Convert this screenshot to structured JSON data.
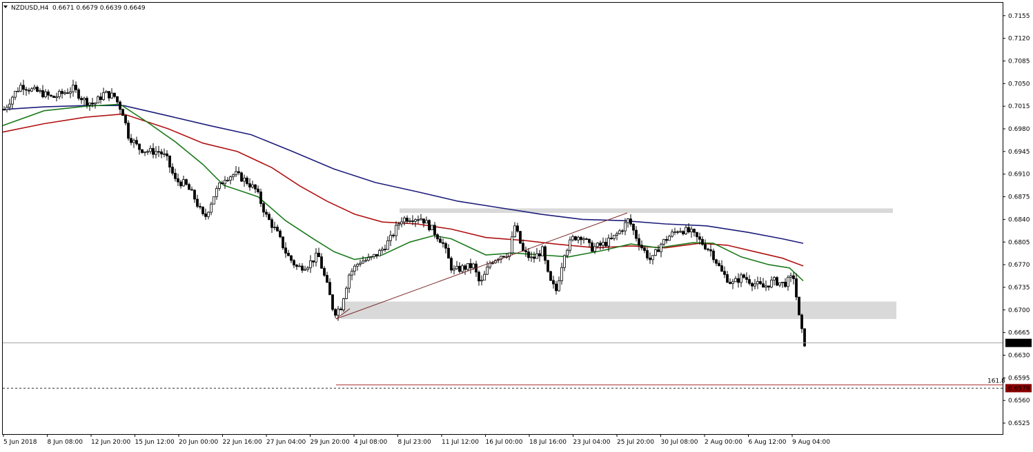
{
  "window": {
    "symbol_header": "NZDUSD,H4",
    "ohlc_header": "0.6671 0.6679 0.6639 0.6649",
    "menu_icon": "triangle-down-icon"
  },
  "chart_data": {
    "type": "candlestick",
    "symbol": "NZDUSD",
    "timeframe": "H4",
    "ylim": [
      0.6508,
      0.7175
    ],
    "y_ticks": [
      0.7155,
      0.712,
      0.7085,
      0.705,
      0.7015,
      0.698,
      0.6945,
      0.691,
      0.6875,
      0.684,
      0.6805,
      0.677,
      0.6735,
      0.67,
      0.6665,
      0.663,
      0.6595,
      0.656,
      0.6525
    ],
    "y_tick_labels": [
      "0.7155",
      "0.7120",
      "0.7085",
      "0.7050",
      "0.7015",
      "0.6980",
      "0.6945",
      "0.6910",
      "0.6875",
      "0.6840",
      "0.6805",
      "0.6770",
      "0.6735",
      "0.6700",
      "0.6665",
      "0.6630",
      "0.6595",
      "0.6560",
      "0.6525"
    ],
    "x_labels": [
      "5 Jun 2018",
      "8 Jun 08:00",
      "12 Jun 20:00",
      "15 Jun 12:00",
      "20 Jun 00:00",
      "22 Jun 16:00",
      "27 Jun 04:00",
      "29 Jun 20:00",
      "4 Jul 08:00",
      "8 Jul 23:00",
      "11 Jul 12:00",
      "16 Jul 00:00",
      "18 Jul 16:00",
      "23 Jul 04:00",
      "25 Jul 20:00",
      "30 Jul 08:00",
      "2 Aug 00:00",
      "6 Aug 12:00",
      "9 Aug 04:00"
    ],
    "price_path": [
      [
        0,
        0.701
      ],
      [
        15,
        0.7035
      ],
      [
        25,
        0.7048
      ],
      [
        40,
        0.704
      ],
      [
        55,
        0.7035
      ],
      [
        70,
        0.7028
      ],
      [
        85,
        0.7035
      ],
      [
        100,
        0.7042
      ],
      [
        115,
        0.7025
      ],
      [
        130,
        0.7018
      ],
      [
        145,
        0.7035
      ],
      [
        160,
        0.703
      ],
      [
        172,
        0.7005
      ],
      [
        180,
        0.697
      ],
      [
        195,
        0.695
      ],
      [
        210,
        0.6945
      ],
      [
        225,
        0.6945
      ],
      [
        235,
        0.6935
      ],
      [
        248,
        0.69
      ],
      [
        262,
        0.6895
      ],
      [
        275,
        0.6875
      ],
      [
        290,
        0.684
      ],
      [
        305,
        0.688
      ],
      [
        320,
        0.6905
      ],
      [
        335,
        0.691
      ],
      [
        350,
        0.69
      ],
      [
        365,
        0.6885
      ],
      [
        380,
        0.6845
      ],
      [
        395,
        0.682
      ],
      [
        410,
        0.6785
      ],
      [
        425,
        0.6765
      ],
      [
        440,
        0.677
      ],
      [
        455,
        0.6785
      ],
      [
        470,
        0.673
      ],
      [
        478,
        0.6695
      ],
      [
        488,
        0.6705
      ],
      [
        500,
        0.6755
      ],
      [
        515,
        0.6775
      ],
      [
        530,
        0.6778
      ],
      [
        545,
        0.679
      ],
      [
        560,
        0.681
      ],
      [
        575,
        0.684
      ],
      [
        590,
        0.6843
      ],
      [
        605,
        0.6842
      ],
      [
        620,
        0.6825
      ],
      [
        635,
        0.6805
      ],
      [
        650,
        0.676
      ],
      [
        665,
        0.6765
      ],
      [
        680,
        0.6768
      ],
      [
        690,
        0.6738
      ],
      [
        705,
        0.6775
      ],
      [
        720,
        0.6785
      ],
      [
        732,
        0.6788
      ],
      [
        740,
        0.683
      ],
      [
        752,
        0.679
      ],
      [
        765,
        0.6778
      ],
      [
        780,
        0.6792
      ],
      [
        790,
        0.6745
      ],
      [
        800,
        0.673
      ],
      [
        812,
        0.679
      ],
      [
        825,
        0.6812
      ],
      [
        838,
        0.6815
      ],
      [
        850,
        0.6795
      ],
      [
        865,
        0.68
      ],
      [
        880,
        0.6808
      ],
      [
        895,
        0.6825
      ],
      [
        905,
        0.684
      ],
      [
        915,
        0.6815
      ],
      [
        925,
        0.6795
      ],
      [
        938,
        0.6775
      ],
      [
        950,
        0.68
      ],
      [
        965,
        0.6815
      ],
      [
        978,
        0.6825
      ],
      [
        995,
        0.682
      ],
      [
        1010,
        0.6805
      ],
      [
        1025,
        0.679
      ],
      [
        1040,
        0.6758
      ],
      [
        1055,
        0.674
      ],
      [
        1070,
        0.6752
      ],
      [
        1085,
        0.6742
      ],
      [
        1100,
        0.6735
      ],
      [
        1115,
        0.6745
      ],
      [
        1130,
        0.674
      ],
      [
        1145,
        0.6752
      ],
      [
        1150,
        0.67
      ],
      [
        1155,
        0.667
      ],
      [
        1160,
        0.6649
      ]
    ],
    "ma_fast_green": [
      [
        0,
        0.6985
      ],
      [
        60,
        0.7008
      ],
      [
        120,
        0.7015
      ],
      [
        170,
        0.7018
      ],
      [
        210,
        0.699
      ],
      [
        250,
        0.696
      ],
      [
        290,
        0.6925
      ],
      [
        320,
        0.6893
      ],
      [
        370,
        0.6875
      ],
      [
        410,
        0.6838
      ],
      [
        450,
        0.681
      ],
      [
        480,
        0.679
      ],
      [
        510,
        0.6778
      ],
      [
        550,
        0.6785
      ],
      [
        590,
        0.6805
      ],
      [
        625,
        0.6815
      ],
      [
        650,
        0.681
      ],
      [
        700,
        0.6785
      ],
      [
        740,
        0.6788
      ],
      [
        780,
        0.6785
      ],
      [
        820,
        0.6782
      ],
      [
        870,
        0.6792
      ],
      [
        910,
        0.6802
      ],
      [
        950,
        0.6796
      ],
      [
        1000,
        0.6804
      ],
      [
        1030,
        0.6803
      ],
      [
        1070,
        0.6782
      ],
      [
        1110,
        0.677
      ],
      [
        1140,
        0.6765
      ],
      [
        1160,
        0.6745
      ]
    ],
    "ma_mid_red": [
      [
        0,
        0.6975
      ],
      [
        60,
        0.6988
      ],
      [
        120,
        0.6998
      ],
      [
        175,
        0.7003
      ],
      [
        240,
        0.698
      ],
      [
        290,
        0.6958
      ],
      [
        340,
        0.6945
      ],
      [
        390,
        0.692
      ],
      [
        430,
        0.6892
      ],
      [
        470,
        0.6868
      ],
      [
        510,
        0.6848
      ],
      [
        550,
        0.6836
      ],
      [
        600,
        0.6833
      ],
      [
        650,
        0.6825
      ],
      [
        700,
        0.6812
      ],
      [
        760,
        0.6807
      ],
      [
        800,
        0.6802
      ],
      [
        860,
        0.6796
      ],
      [
        910,
        0.6799
      ],
      [
        960,
        0.6796
      ],
      [
        1010,
        0.6803
      ],
      [
        1050,
        0.68
      ],
      [
        1090,
        0.679
      ],
      [
        1130,
        0.678
      ],
      [
        1160,
        0.6768
      ]
    ],
    "ma_slow_blue": [
      [
        0,
        0.701
      ],
      [
        60,
        0.7014
      ],
      [
        120,
        0.7016
      ],
      [
        175,
        0.7016
      ],
      [
        240,
        0.7
      ],
      [
        300,
        0.6985
      ],
      [
        360,
        0.6971
      ],
      [
        420,
        0.6945
      ],
      [
        480,
        0.6918
      ],
      [
        540,
        0.6897
      ],
      [
        600,
        0.6883
      ],
      [
        660,
        0.6868
      ],
      [
        720,
        0.6858
      ],
      [
        780,
        0.6848
      ],
      [
        840,
        0.684
      ],
      [
        900,
        0.6838
      ],
      [
        960,
        0.6833
      ],
      [
        1020,
        0.683
      ],
      [
        1080,
        0.682
      ],
      [
        1130,
        0.681
      ],
      [
        1160,
        0.6803
      ]
    ],
    "zones": [
      {
        "name": "resistance-zone",
        "x0": 575,
        "x1": 1290,
        "y_top": 0.6857,
        "y_bottom": 0.685
      },
      {
        "name": "support-zone",
        "x0": 490,
        "x1": 1295,
        "y_top": 0.6713,
        "y_bottom": 0.6686
      }
    ],
    "trendline": {
      "x0": 483,
      "y0": 0.6686,
      "x1": 905,
      "y1": 0.685
    },
    "fib_level": {
      "label": "161.8",
      "value": 0.6584,
      "x0": 483
    },
    "current_price": {
      "label": "0.6649",
      "value": 0.6649
    },
    "target_price": {
      "label": "0.6579",
      "value": 0.6579
    },
    "colors": {
      "background": "#ffffff",
      "candle": "#000000",
      "ma_fast": "#1a7a1a",
      "ma_mid": "#b01010",
      "ma_slow": "#1c1c7a",
      "zone": "#d9d9d9",
      "trendline": "#7a2a2a",
      "fib": "#b03030",
      "target_label_bg": "#8b0000",
      "price_label_bg": "#000000"
    }
  }
}
